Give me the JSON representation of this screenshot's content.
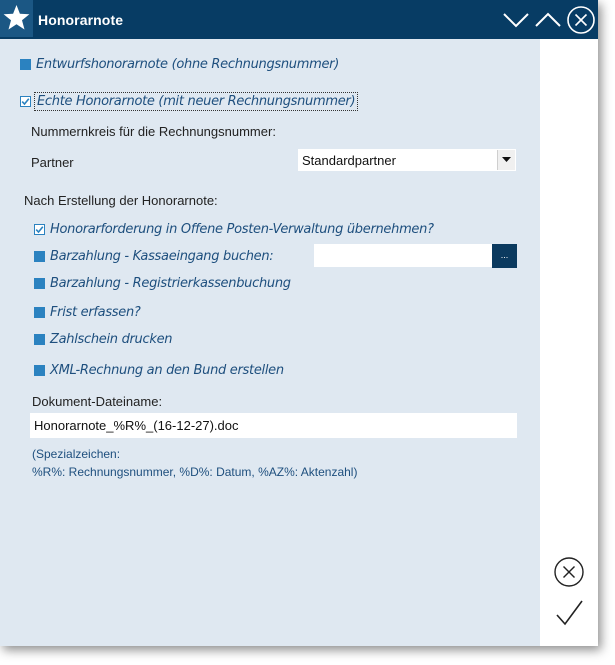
{
  "window": {
    "title": "Honorarnote",
    "accent": "#073c64"
  },
  "options": {
    "draft": {
      "label": "Entwurfshonorarnote (ohne Rechnungsnummer)",
      "checked": false
    },
    "real": {
      "label": "Echte Honorarnote (mit neuer Rechnungsnummer)",
      "checked": true
    }
  },
  "number_range": {
    "heading": "Nummernkreis für die Rechnungsnummer:",
    "partner_label": "Partner",
    "partner_value": "Standardpartner"
  },
  "after_creation": {
    "heading": "Nach Erstellung der Honorarnote:",
    "items": [
      {
        "label": "Honorarforderung in Offene Posten-Verwaltung übernehmen?",
        "checked": true
      },
      {
        "label": "Barzahlung - Kassaeingang buchen:",
        "checked": false
      },
      {
        "label": "Barzahlung - Registrierkassenbuchung",
        "checked": false
      },
      {
        "label": "Frist erfassen?",
        "checked": false
      },
      {
        "label": "Zahlschein drucken",
        "checked": false
      },
      {
        "label": "XML-Rechnung an den Bund erstellen",
        "checked": false
      }
    ],
    "kassa_input_value": "",
    "browse_label": "..."
  },
  "document": {
    "label": "Dokument-Dateiname:",
    "value": "Honorarnote_%R%_(16-12-27).doc",
    "hint_line1": "(Spezialzeichen:",
    "hint_line2": "%R%: Rechnungsnummer, %D%: Datum, %AZ%: Aktenzahl)"
  },
  "icons": {
    "app": "star-icon",
    "minimize": "chevron-down-icon",
    "maximize": "chevron-up-icon",
    "close": "close-circle-icon",
    "cancel": "cancel-circle-icon",
    "confirm": "checkmark-icon"
  }
}
